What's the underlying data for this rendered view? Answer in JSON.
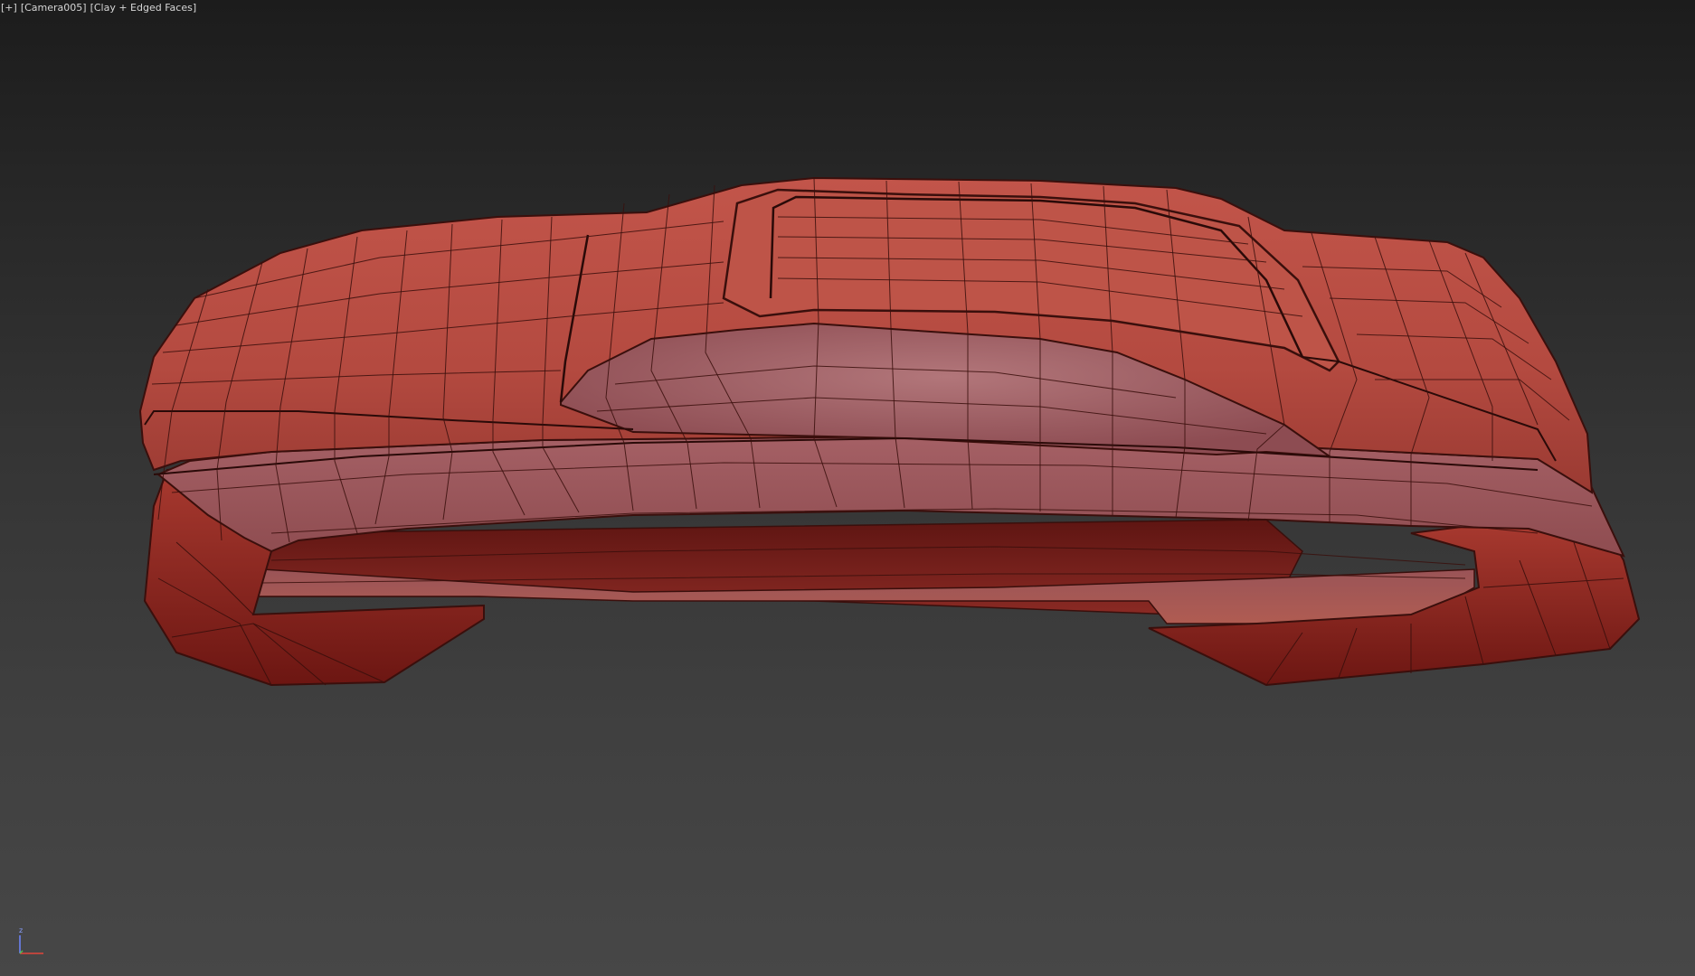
{
  "viewport": {
    "label_plus": "[+]",
    "label_camera": "[Camera005]",
    "label_shading": "[Clay + Edged Faces]",
    "background_top": "#1c1c1c",
    "background_bottom": "#474747"
  },
  "model": {
    "clay_color": "#b94a40",
    "clay_light": "#c85a4e",
    "clay_dark": "#6e1814",
    "interior_color": "#9a5a5c",
    "wire_color": "#3a0f0c"
  },
  "gizmo": {
    "axis_label": "z",
    "x_color": "#e0453a",
    "z_color": "#6f86ff"
  }
}
